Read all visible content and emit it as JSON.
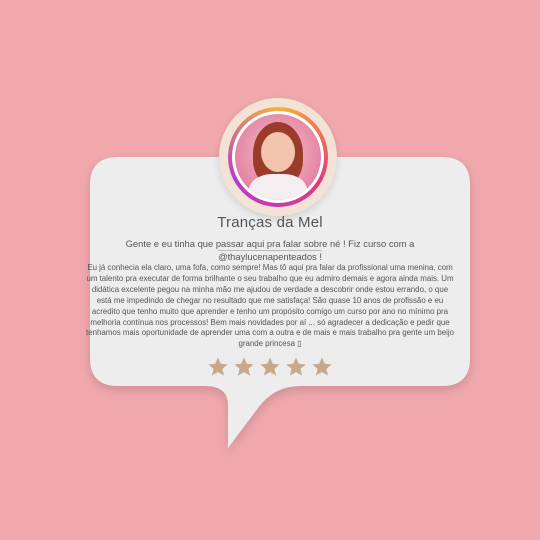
{
  "review": {
    "name": "Tranças da Mel",
    "intro_line1": "Gente e eu tinha que passar aqui pra falar sobre né ! Fiz curso com a",
    "handle": "@thaylucenapenteados !",
    "body": "Eu já conhecia ela claro, uma fofa, como sempre! Mas tô aqui pra falar da profissional uma menina, com um talento pra executar de forma brilhante o seu trabalho que eu admiro demais e agora ainda mais. Um didática excelente pegou na minha mão me ajudou de verdade a descobrir onde estou errando, o que está me impedindo de chegar no resultado que me satisfaça! São quase 10 anos de profissão e eu acredito que tenho muito que aprender e tenho um propósito comigo um curso por ano no mínimo pra melhoria contínua nos processos! Bem mais novidades por aí ... só agradecer a dedicação e pedir que tenhamos mais oportunidade de aprender uma com a outra e de mais e mais trabalho pra gente um beijo grande princesa ",
    "body_trailing_glyph": "▯",
    "rating": 5,
    "rating_max": 5
  },
  "colors": {
    "background": "#f0a8ad",
    "card": "#eeeeee",
    "star": "#c9a98e",
    "text": "#555555"
  },
  "icons": {
    "avatar": "profile-photo",
    "star": "star-icon"
  }
}
